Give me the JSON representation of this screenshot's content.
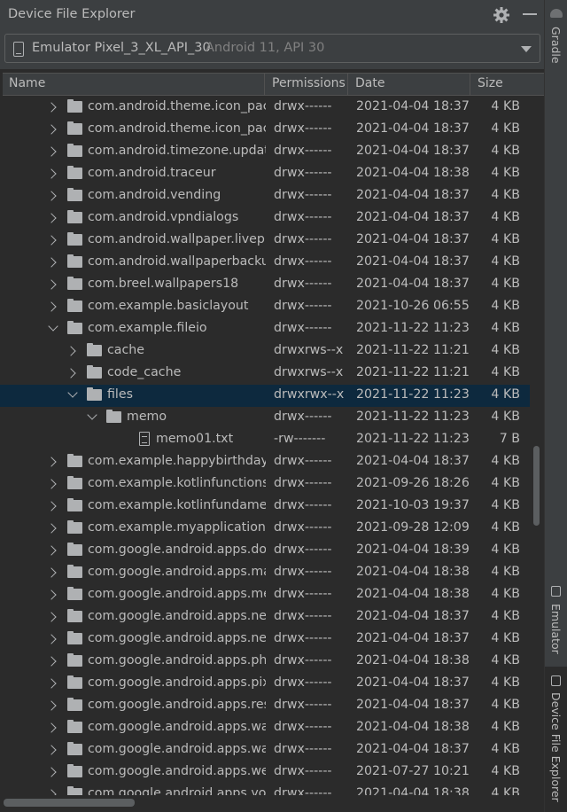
{
  "panel": {
    "title": "Device File Explorer"
  },
  "device": {
    "name": "Emulator Pixel_3_XL_API_30",
    "api": "Android 11, API 30"
  },
  "columns": {
    "name": "Name",
    "permissions": "Permissions",
    "date": "Date",
    "size": "Size"
  },
  "rows": [
    {
      "depth": 0,
      "type": "folder",
      "state": "closed",
      "name": "com.android.theme.icon_pack.circular.android",
      "perm": "drwx------",
      "date": "2021-04-04 18:37",
      "size": "4 KB"
    },
    {
      "depth": 0,
      "type": "folder",
      "state": "closed",
      "name": "com.android.theme.icon_pack.filled.android",
      "perm": "drwx------",
      "date": "2021-04-04 18:37",
      "size": "4 KB"
    },
    {
      "depth": 0,
      "type": "folder",
      "state": "closed",
      "name": "com.android.timezone.updater",
      "perm": "drwx------",
      "date": "2021-04-04 18:37",
      "size": "4 KB"
    },
    {
      "depth": 0,
      "type": "folder",
      "state": "closed",
      "name": "com.android.traceur",
      "perm": "drwx------",
      "date": "2021-04-04 18:38",
      "size": "4 KB"
    },
    {
      "depth": 0,
      "type": "folder",
      "state": "closed",
      "name": "com.android.vending",
      "perm": "drwx------",
      "date": "2021-04-04 18:37",
      "size": "4 KB"
    },
    {
      "depth": 0,
      "type": "folder",
      "state": "closed",
      "name": "com.android.vpndialogs",
      "perm": "drwx------",
      "date": "2021-04-04 18:37",
      "size": "4 KB"
    },
    {
      "depth": 0,
      "type": "folder",
      "state": "closed",
      "name": "com.android.wallpaper.livepicker",
      "perm": "drwx------",
      "date": "2021-04-04 18:37",
      "size": "4 KB"
    },
    {
      "depth": 0,
      "type": "folder",
      "state": "closed",
      "name": "com.android.wallpaperbackup",
      "perm": "drwx------",
      "date": "2021-04-04 18:37",
      "size": "4 KB"
    },
    {
      "depth": 0,
      "type": "folder",
      "state": "closed",
      "name": "com.breel.wallpapers18",
      "perm": "drwx------",
      "date": "2021-04-04 18:37",
      "size": "4 KB"
    },
    {
      "depth": 0,
      "type": "folder",
      "state": "closed",
      "name": "com.example.basiclayout",
      "perm": "drwx------",
      "date": "2021-10-26 06:55",
      "size": "4 KB"
    },
    {
      "depth": 0,
      "type": "folder",
      "state": "open",
      "name": "com.example.fileio",
      "perm": "drwx------",
      "date": "2021-11-22 11:23",
      "size": "4 KB"
    },
    {
      "depth": 1,
      "type": "folder",
      "state": "closed",
      "name": "cache",
      "perm": "drwxrws--x",
      "date": "2021-11-22 11:21",
      "size": "4 KB"
    },
    {
      "depth": 1,
      "type": "folder",
      "state": "closed",
      "name": "code_cache",
      "perm": "drwxrws--x",
      "date": "2021-11-22 11:21",
      "size": "4 KB"
    },
    {
      "depth": 1,
      "type": "folder",
      "state": "open",
      "name": "files",
      "perm": "drwxrwx--x",
      "date": "2021-11-22 11:23",
      "size": "4 KB",
      "selected": true
    },
    {
      "depth": 2,
      "type": "folder",
      "state": "open",
      "name": "memo",
      "perm": "drwx------",
      "date": "2021-11-22 11:23",
      "size": "4 KB"
    },
    {
      "depth": 3,
      "type": "file",
      "state": "none",
      "name": "memo01.txt",
      "perm": "-rw-------",
      "date": "2021-11-22 11:23",
      "size": "7 B"
    },
    {
      "depth": 0,
      "type": "folder",
      "state": "closed",
      "name": "com.example.happybirthday",
      "perm": "drwx------",
      "date": "2021-04-04 18:37",
      "size": "4 KB"
    },
    {
      "depth": 0,
      "type": "folder",
      "state": "closed",
      "name": "com.example.kotlinfunctions",
      "perm": "drwx------",
      "date": "2021-09-26 18:26",
      "size": "4 KB"
    },
    {
      "depth": 0,
      "type": "folder",
      "state": "closed",
      "name": "com.example.kotlinfundamentals",
      "perm": "drwx------",
      "date": "2021-10-03 19:37",
      "size": "4 KB"
    },
    {
      "depth": 0,
      "type": "folder",
      "state": "closed",
      "name": "com.example.myapplication",
      "perm": "drwx------",
      "date": "2021-09-28 12:09",
      "size": "4 KB"
    },
    {
      "depth": 0,
      "type": "folder",
      "state": "closed",
      "name": "com.google.android.apps.docs",
      "perm": "drwx------",
      "date": "2021-04-04 18:39",
      "size": "4 KB"
    },
    {
      "depth": 0,
      "type": "folder",
      "state": "closed",
      "name": "com.google.android.apps.maps",
      "perm": "drwx------",
      "date": "2021-04-04 18:38",
      "size": "4 KB"
    },
    {
      "depth": 0,
      "type": "folder",
      "state": "closed",
      "name": "com.google.android.apps.messaging",
      "perm": "drwx------",
      "date": "2021-04-04 18:38",
      "size": "4 KB"
    },
    {
      "depth": 0,
      "type": "folder",
      "state": "closed",
      "name": "com.google.android.apps.nexuslauncher",
      "perm": "drwx------",
      "date": "2021-04-04 18:37",
      "size": "4 KB"
    },
    {
      "depth": 0,
      "type": "folder",
      "state": "closed",
      "name": "com.google.android.apps.nexuslauncher.overlay",
      "perm": "drwx------",
      "date": "2021-04-04 18:37",
      "size": "4 KB"
    },
    {
      "depth": 0,
      "type": "folder",
      "state": "closed",
      "name": "com.google.android.apps.photos",
      "perm": "drwx------",
      "date": "2021-04-04 18:38",
      "size": "4 KB"
    },
    {
      "depth": 0,
      "type": "folder",
      "state": "closed",
      "name": "com.google.android.apps.pixelmigrate",
      "perm": "drwx------",
      "date": "2021-04-04 18:37",
      "size": "4 KB"
    },
    {
      "depth": 0,
      "type": "folder",
      "state": "closed",
      "name": "com.google.android.apps.restore",
      "perm": "drwx------",
      "date": "2021-04-04 18:37",
      "size": "4 KB"
    },
    {
      "depth": 0,
      "type": "folder",
      "state": "closed",
      "name": "com.google.android.apps.wallpaper",
      "perm": "drwx------",
      "date": "2021-04-04 18:38",
      "size": "4 KB"
    },
    {
      "depth": 0,
      "type": "folder",
      "state": "closed",
      "name": "com.google.android.apps.wallpaper.nexus",
      "perm": "drwx------",
      "date": "2021-04-04 18:37",
      "size": "4 KB"
    },
    {
      "depth": 0,
      "type": "folder",
      "state": "closed",
      "name": "com.google.android.apps.wellbeing",
      "perm": "drwx------",
      "date": "2021-07-27 10:21",
      "size": "4 KB"
    },
    {
      "depth": 0,
      "type": "folder",
      "state": "closed",
      "name": "com.google.android.apps.youtube.music",
      "perm": "drwx------",
      "date": "2021-04-04 18:38",
      "size": "4 KB"
    }
  ],
  "side_stripe": {
    "gradle": "Gradle",
    "emulator": "Emulator",
    "device_file_explorer": "Device File Explorer"
  }
}
